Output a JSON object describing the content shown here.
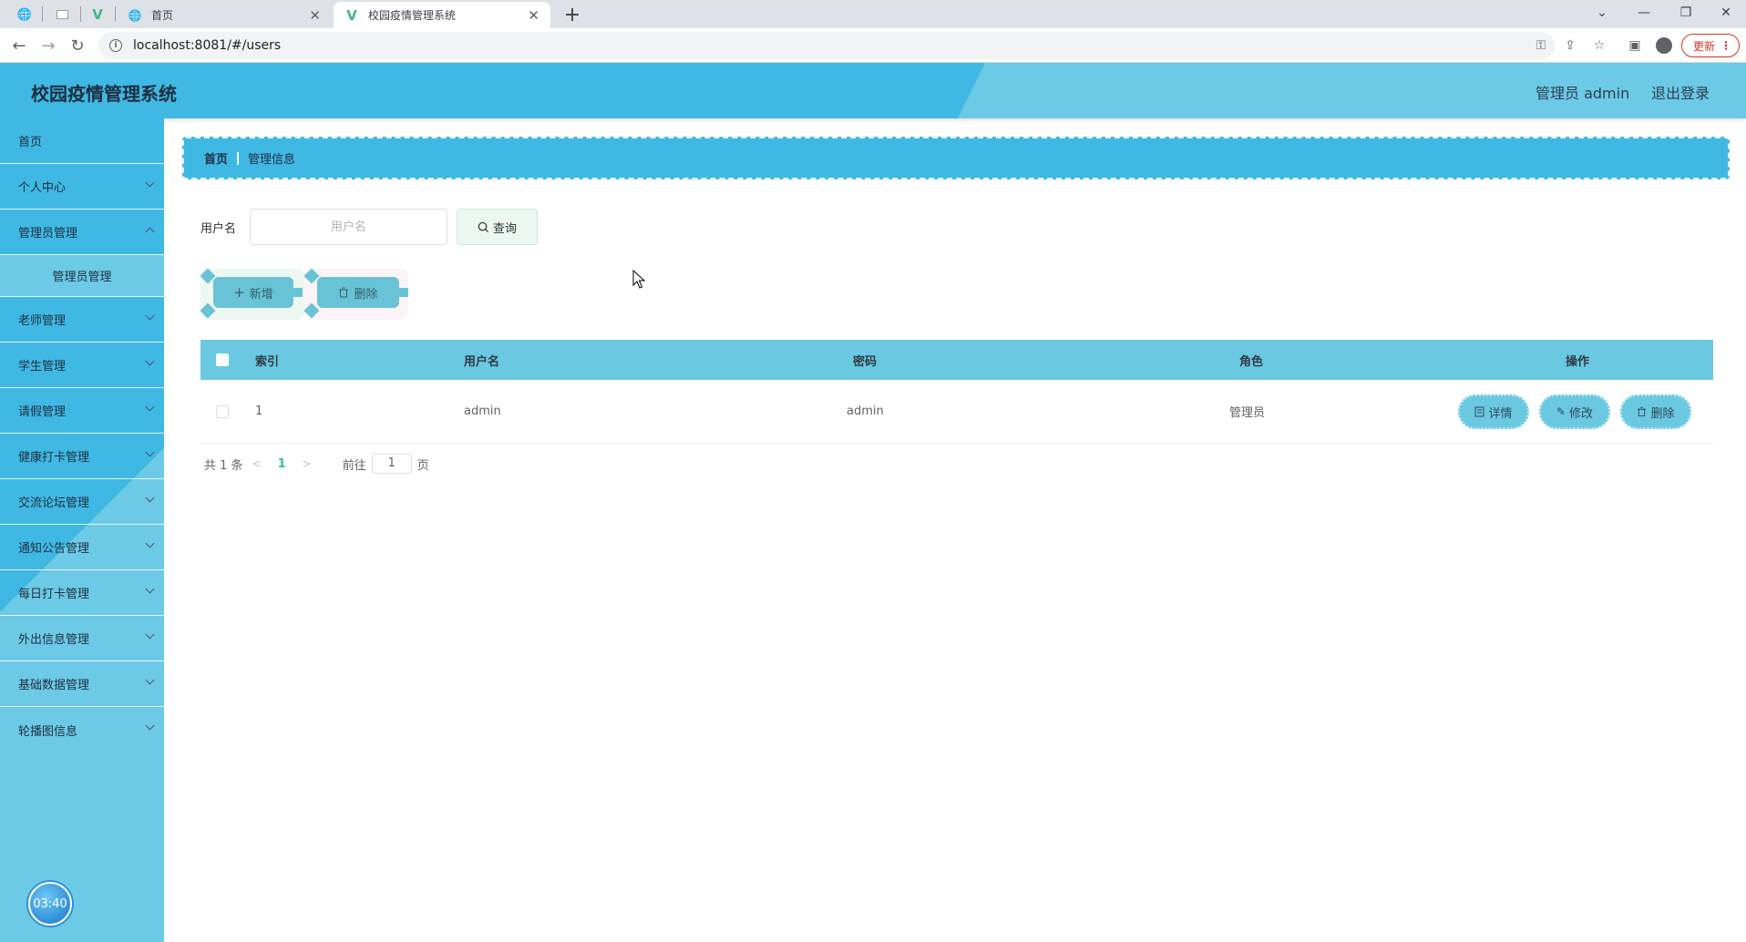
{
  "browser": {
    "tabs": [
      {
        "title": "首页",
        "active": false
      },
      {
        "title": "校园疫情管理系统",
        "active": true
      }
    ],
    "url": "localhost:8081/#/users",
    "update_label": "更新"
  },
  "header": {
    "title": "校园疫情管理系统",
    "user": "管理员 admin",
    "logout": "退出登录"
  },
  "sidebar": {
    "items": [
      {
        "label": "首页",
        "expandable": false
      },
      {
        "label": "个人中心",
        "expandable": true
      },
      {
        "label": "管理员管理",
        "expandable": true
      },
      {
        "label": "管理员管理",
        "sub": true
      },
      {
        "label": "老师管理",
        "expandable": true
      },
      {
        "label": "学生管理",
        "expandable": true
      },
      {
        "label": "请假管理",
        "expandable": true
      },
      {
        "label": "健康打卡管理",
        "expandable": true
      },
      {
        "label": "交流论坛管理",
        "expandable": true
      },
      {
        "label": "通知公告管理",
        "expandable": true
      },
      {
        "label": "每日打卡管理",
        "expandable": true
      },
      {
        "label": "外出信息管理",
        "expandable": true
      },
      {
        "label": "基础数据管理",
        "expandable": true
      },
      {
        "label": "轮播图信息",
        "expandable": true
      }
    ],
    "clock": "03:40"
  },
  "breadcrumb": {
    "home": "首页",
    "current": "管理信息"
  },
  "search": {
    "label": "用户名",
    "placeholder": "用户名",
    "value": "",
    "button": "查询"
  },
  "actions": {
    "add": "新增",
    "delete": "删除"
  },
  "table": {
    "columns": [
      "索引",
      "用户名",
      "密码",
      "角色",
      "操作"
    ],
    "rows": [
      {
        "index": "1",
        "username": "admin",
        "password": "admin",
        "role": "管理员"
      }
    ],
    "row_actions": {
      "detail": "详情",
      "edit": "修改",
      "delete": "删除"
    }
  },
  "pagination": {
    "total": "共 1 条",
    "current_page": "1",
    "goto_label": "前往",
    "goto_value": "1",
    "page_suffix": "页"
  },
  "colors": {
    "primary": "#3fb8e4",
    "secondary": "#6ccae6",
    "table_header": "#6ac8e1"
  }
}
